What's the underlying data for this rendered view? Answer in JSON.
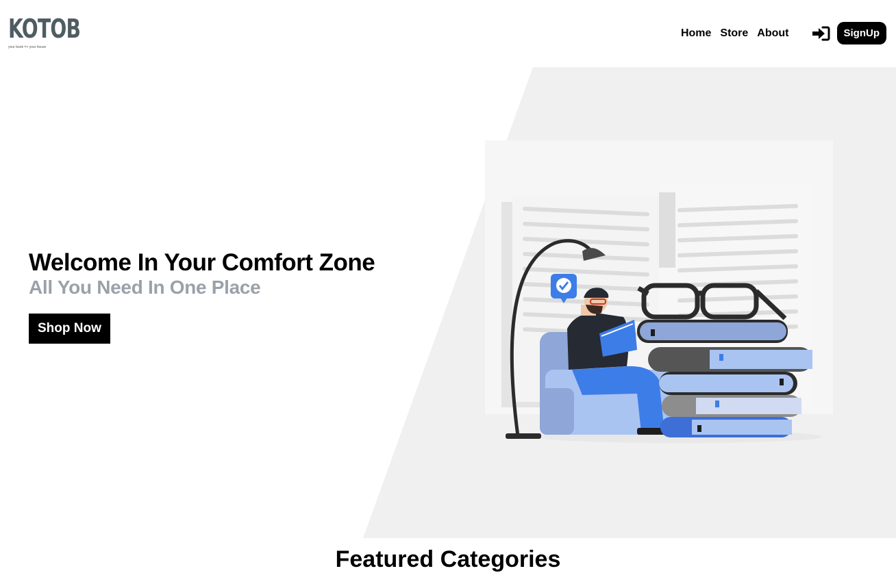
{
  "brand": {
    "name": "KOTOB",
    "tagline": "your book => your house"
  },
  "nav": {
    "links": [
      "Home",
      "Store",
      "About"
    ],
    "login_icon": "sign-in-icon",
    "signup_label": "SignUp"
  },
  "hero": {
    "title": "Welcome In Your Comfort Zone",
    "subtitle": "All You Need In One Place",
    "cta_label": "Shop Now"
  },
  "section": {
    "featured_title": "Featured Categories"
  },
  "colors": {
    "brand_text": "#4f5d63",
    "hero_panel": "#f0f0f0",
    "subtitle": "#9aa1a9",
    "illustration_blue": "#3d7de8",
    "illustration_light_blue": "#aac4f2"
  }
}
